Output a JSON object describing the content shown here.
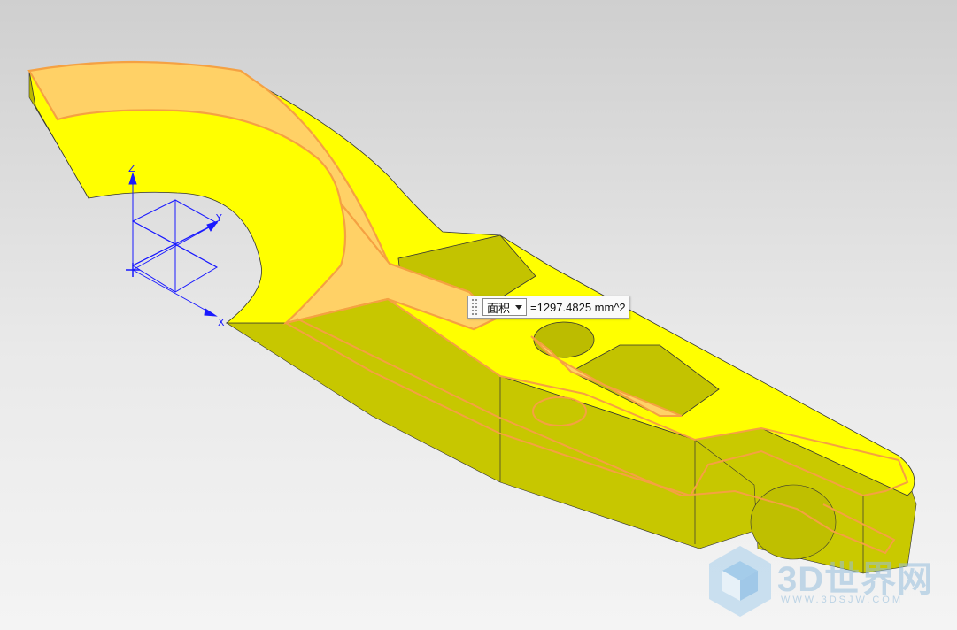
{
  "viewport": {
    "background_top": "#cfcfcf",
    "background_bottom": "#f4f4f4"
  },
  "model": {
    "face_color": "#ffff00",
    "side_color": "#c8c800",
    "selected_face_color": "#ffd166",
    "highlight_edge_color": "#f5a142"
  },
  "triad": {
    "color": "#1a1aff",
    "z_label": "Z",
    "y_label": "Y",
    "x_label": "X"
  },
  "measure": {
    "type": "面积",
    "value": "=1297.4825 mm^2"
  },
  "watermark": {
    "title": "3D世界网",
    "url": "WWW.3DSJW.COM",
    "logo_icon": "cube-logo-icon"
  }
}
